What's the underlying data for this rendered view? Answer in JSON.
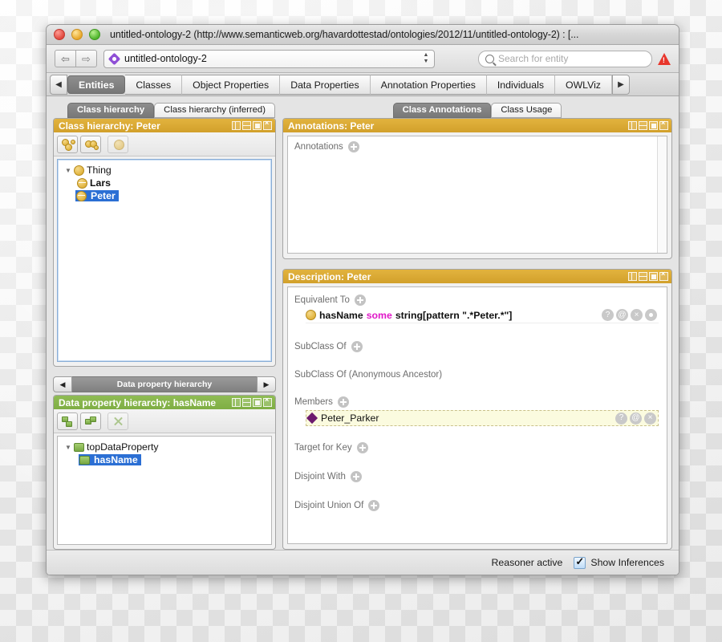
{
  "window": {
    "title": "untitled-ontology-2 (http://www.semanticweb.org/havardottestad/ontologies/2012/11/untitled-ontology-2)  : [...",
    "traffic": {
      "close": "close-button",
      "minimize": "minimize-button",
      "zoom": "zoom-button"
    }
  },
  "toolbar": {
    "back_label": "⇦",
    "forward_label": "⇨",
    "ontology_name": "untitled-ontology-2",
    "search_placeholder": "Search for entity",
    "warning_label": "!"
  },
  "tabs": {
    "scroll_left": "◀",
    "scroll_right": "▶",
    "items": [
      {
        "label": "Entities",
        "active": true
      },
      {
        "label": "Classes",
        "active": false
      },
      {
        "label": "Object Properties",
        "active": false
      },
      {
        "label": "Data Properties",
        "active": false
      },
      {
        "label": "Annotation Properties",
        "active": false
      },
      {
        "label": "Individuals",
        "active": false
      },
      {
        "label": "OWLViz",
        "active": false
      }
    ]
  },
  "class_hierarchy": {
    "tabs": [
      {
        "label": "Class hierarchy",
        "active": true
      },
      {
        "label": "Class hierarchy (inferred)",
        "active": false
      }
    ],
    "panel_title": "Class hierarchy: Peter",
    "toolbar_buttons": [
      "add-subclass-icon",
      "add-sibling-class-icon",
      "delete-class-icon"
    ],
    "tree": [
      {
        "label": "Thing",
        "level": 0,
        "twisty": "▼",
        "icon": "owl-class-icon",
        "selected": false,
        "bold": false
      },
      {
        "label": "Lars",
        "level": 1,
        "twisty": "",
        "icon": "owl-class-icon",
        "selected": false,
        "bold": true
      },
      {
        "label": "Peter",
        "level": 1,
        "twisty": "",
        "icon": "owl-class-icon",
        "selected": true,
        "bold": true
      }
    ]
  },
  "data_property_hierarchy": {
    "nav_left": "◀",
    "nav_right": "▶",
    "nav_title": "Data property hierarchy",
    "panel_title": "Data property hierarchy: hasName",
    "toolbar_buttons": [
      "add-subproperty-icon",
      "add-sibling-property-icon",
      "delete-property-icon"
    ],
    "tree": [
      {
        "label": "topDataProperty",
        "level": 0,
        "twisty": "▼",
        "icon": "data-property-icon",
        "selected": false,
        "bold": false
      },
      {
        "label": "hasName",
        "level": 1,
        "twisty": "",
        "icon": "data-property-icon",
        "selected": true,
        "bold": true
      }
    ]
  },
  "annotations_panel": {
    "tabs": [
      {
        "label": "Class Annotations",
        "active": true
      },
      {
        "label": "Class Usage",
        "active": false
      }
    ],
    "panel_title": "Annotations: Peter",
    "section_label": "Annotations",
    "add_label": "+"
  },
  "description_panel": {
    "panel_title": "Description: Peter",
    "sections": [
      {
        "label": "Equivalent To",
        "add": true,
        "rows": [
          {
            "icon": "owl-class-icon",
            "prefix": "hasName",
            "keyword": "some",
            "suffix": "string[pattern \".*Peter.*\"]",
            "buttons": [
              "?",
              "@",
              "×",
              "○"
            ],
            "highlight": false
          }
        ]
      },
      {
        "label": "SubClass Of",
        "add": true,
        "rows": []
      },
      {
        "label": "SubClass Of (Anonymous Ancestor)",
        "add": false,
        "rows": []
      },
      {
        "label": "Members",
        "add": true,
        "rows": [
          {
            "icon": "individual-icon",
            "prefix": "Peter_Parker",
            "keyword": "",
            "suffix": "",
            "buttons": [
              "?",
              "@",
              "×"
            ],
            "highlight": true
          }
        ]
      },
      {
        "label": "Target for Key",
        "add": true,
        "rows": []
      },
      {
        "label": "Disjoint With",
        "add": true,
        "rows": []
      },
      {
        "label": "Disjoint Union Of",
        "add": true,
        "rows": []
      }
    ]
  },
  "statusbar": {
    "reasoner_text": "Reasoner active",
    "show_inferences_label": "Show Inferences",
    "show_inferences_checked": true
  },
  "colors": {
    "gold_header": "#d9a82f",
    "green_header": "#84b34a",
    "selection_blue": "#2b6fd4",
    "keyword_magenta": "#e018c8",
    "individual_purple": "#6d1b6d",
    "warning_red": "#e8362c"
  }
}
